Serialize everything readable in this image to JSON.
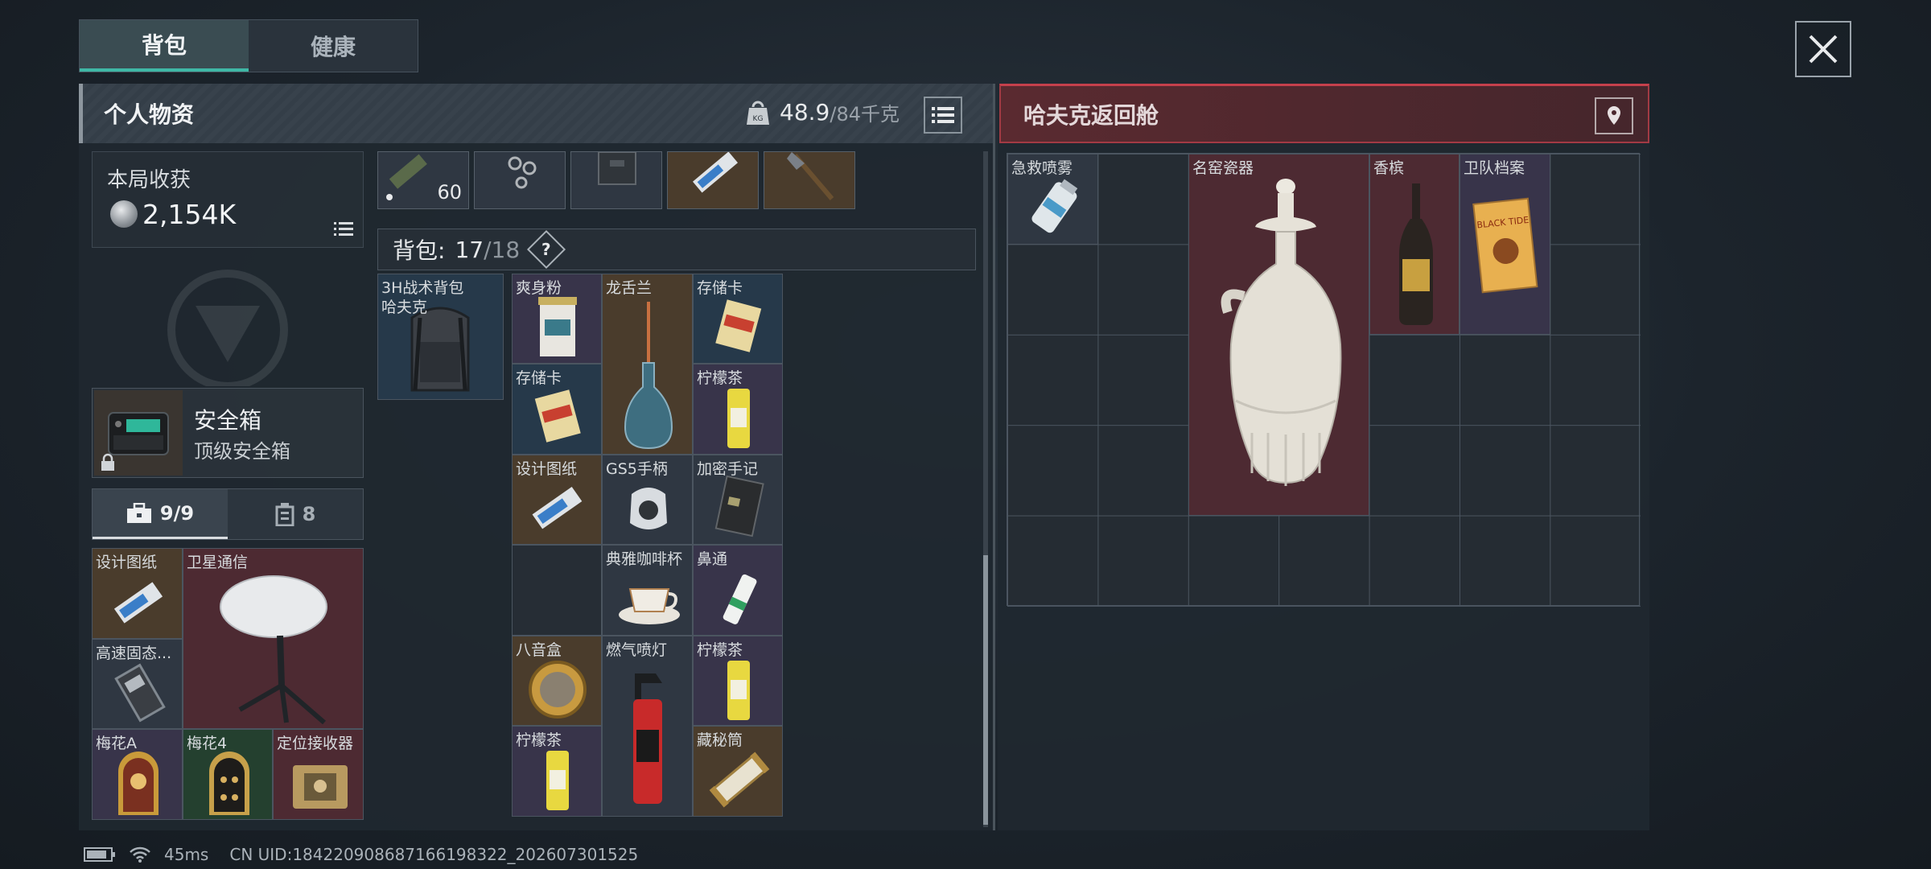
{
  "tabs": {
    "backpack": "背包",
    "health": "健康"
  },
  "left_panel": {
    "title": "个人物资",
    "weight_current": "48.9",
    "weight_max": "/84千克"
  },
  "right_panel": {
    "title": "哈夫克返回舱"
  },
  "loot": {
    "title": "本局收获",
    "value": "2,154K"
  },
  "ammo_count": "60",
  "safe_box": {
    "name": "安全箱",
    "type": "顶级安全箱"
  },
  "container_tabs": {
    "tab1": "9/9",
    "tab2": "8"
  },
  "backpack": {
    "label": "背包:",
    "used": "17",
    "total": "/18",
    "help": "?"
  },
  "backpack_item": {
    "name": "3H战术背包",
    "sub": "哈夫克"
  },
  "safe_items": [
    "设计图纸",
    "卫星通信",
    "高速固态...",
    "梅花A",
    "梅花4",
    "定位接收器"
  ],
  "bag_items": [
    "爽身粉",
    "龙舌兰",
    "存储卡",
    "存储卡",
    "柠檬茶",
    "设计图纸",
    "GS5手柄",
    "加密手记",
    "典雅咖啡杯",
    "鼻通",
    "八音盒",
    "燃气喷灯",
    "柠檬茶",
    "柠檬茶",
    "藏秘筒"
  ],
  "pod_items": [
    "急救喷雾",
    "名窑瓷器",
    "香槟",
    "卫队档案"
  ],
  "dossier_cover": "BLACK TIDE",
  "footer": {
    "ping": "45ms",
    "uid": "CN UID:184220908687166198322_202607301525"
  }
}
